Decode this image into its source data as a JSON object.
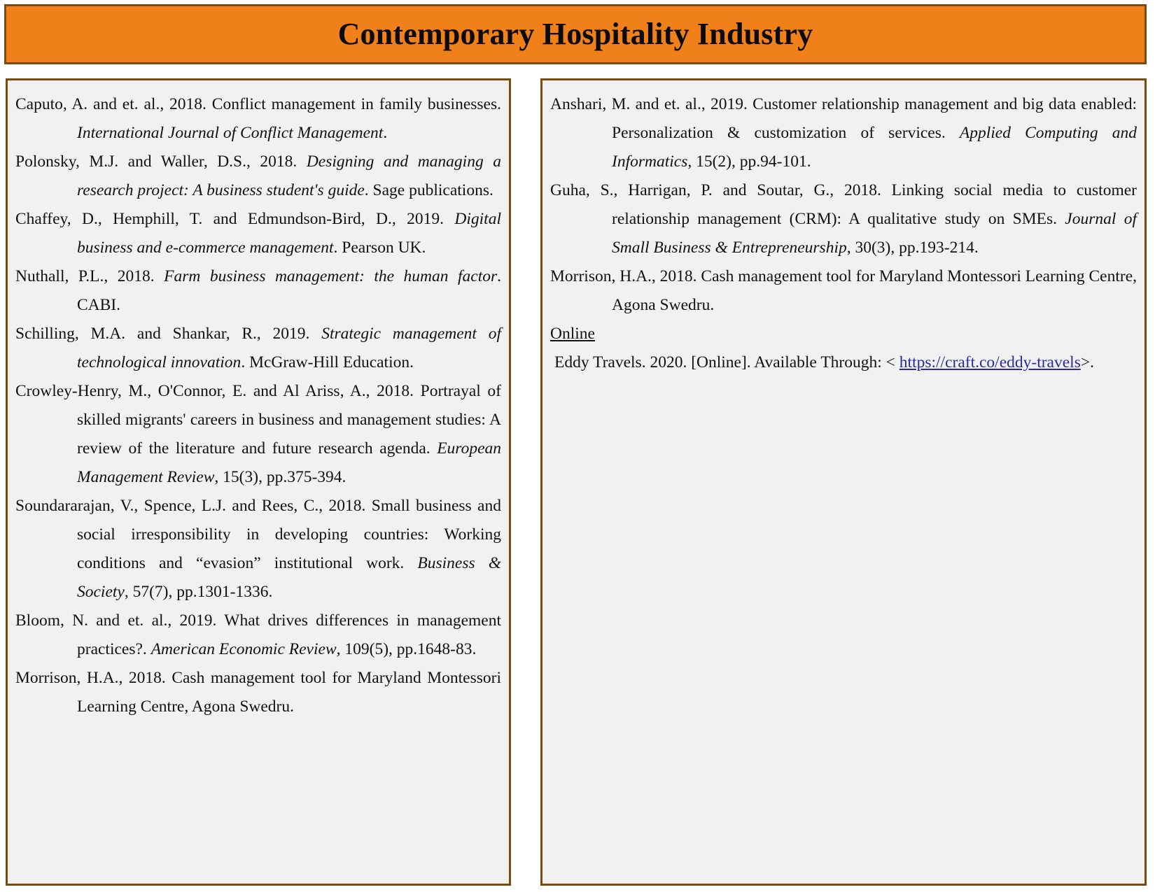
{
  "header": {
    "title": "Contemporary Hospitality Industry",
    "background_color": "#f08019",
    "border_color": "#7a4b10",
    "text_color": "#0b0b0b"
  },
  "theme": {
    "box_background": "#f1f1f1",
    "box_border": "#7a4b10",
    "body_text": "#111111",
    "link_color": "#2a2a9e"
  },
  "left_column": {
    "references": [
      {
        "id": "caputo-2018",
        "pre": "Caputo, A. and et. al., 2018. Conflict management in family businesses. ",
        "italic": "International Journal of Conflict Management",
        "post": "."
      },
      {
        "id": "polonsky-waller-2018",
        "pre": "Polonsky, M.J. and Waller, D.S., 2018. ",
        "italic": "Designing and managing a research project: A business student's guide",
        "post": ". Sage publications."
      },
      {
        "id": "chaffey-2019",
        "pre": "Chaffey, D., Hemphill, T. and Edmundson-Bird, D., 2019. ",
        "italic": "Digital business and e-commerce management",
        "post": ". Pearson UK."
      },
      {
        "id": "nuthall-2018",
        "pre": "Nuthall, P.L., 2018. ",
        "italic": "Farm business management: the human factor",
        "post": ". CABI."
      },
      {
        "id": "schilling-shankar-2019",
        "pre": "Schilling, M.A. and Shankar, R., 2019. ",
        "italic": "Strategic management of technological innovation",
        "post": ". McGraw-Hill Education."
      },
      {
        "id": "crowley-henry-2018",
        "pre": "Crowley-Henry, M., O'Connor, E. and Al Ariss, A., 2018. Portrayal of skilled migrants' careers in business and management studies: A review of the literature and future research agenda. ",
        "italic": "European Management Review",
        "post": ", 15(3), pp.375-394."
      },
      {
        "id": "soundararajan-2018",
        "pre": "Soundararajan, V., Spence, L.J. and Rees, C., 2018. Small business and social irresponsibility in developing countries: Working conditions and “evasion” institutional work. ",
        "italic": "Business & Society",
        "post": ", 57(7), pp.1301-1336."
      },
      {
        "id": "bloom-2019",
        "pre": "Bloom, N. and et. al., 2019. What drives differences in management practices?. ",
        "italic": "American Economic Review",
        "post": ", 109(5), pp.1648-83."
      },
      {
        "id": "morrison-2018-left",
        "pre": "Morrison, H.A., 2018. Cash management tool for Maryland Montessori Learning Centre, Agona Swedru.",
        "italic": "",
        "post": ""
      }
    ]
  },
  "right_column": {
    "references": [
      {
        "id": "anshari-2019",
        "pre": "Anshari, M. and et. al., 2019. Customer relationship management and big data enabled: Personalization & customization of services. ",
        "italic": "Applied Computing and Informatics",
        "post": ", 15(2), pp.94-101."
      },
      {
        "id": "guha-2018",
        "pre": "Guha, S., Harrigan, P. and Soutar, G., 2018. Linking social media to customer relationship management (CRM): A qualitative study on SMEs. ",
        "italic": "Journal of Small Business & Entrepreneurship",
        "post": ", 30(3), pp.193-214."
      },
      {
        "id": "morrison-2018-right",
        "pre": "Morrison, H.A., 2018. Cash management tool for Maryland Montessori Learning Centre, Agona Swedru.",
        "italic": "",
        "post": ""
      }
    ],
    "online_heading": "Online",
    "online_entry": {
      "prefix": "Eddy Travels. 2020. [Online]. Available Through: < ",
      "link_text": "https://craft.co/eddy-travels",
      "suffix": ">."
    }
  }
}
